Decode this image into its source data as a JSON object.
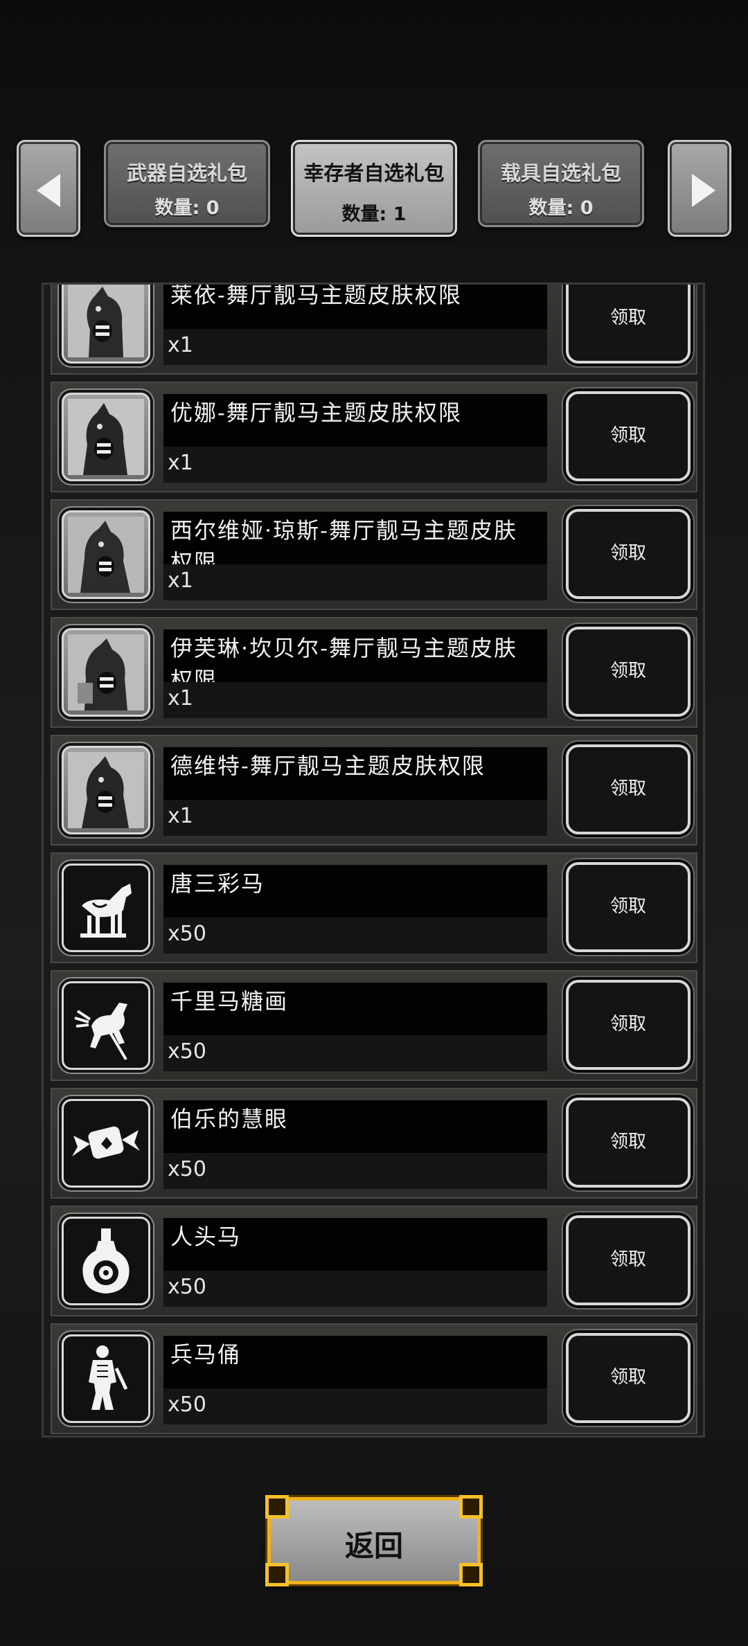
{
  "tabs": [
    {
      "title": "武器自选礼包",
      "count_label": "数量: 0",
      "active": false
    },
    {
      "title": "幸存者自选礼包",
      "count_label": "数量: 1",
      "active": true
    },
    {
      "title": "载具自选礼包",
      "count_label": "数量: 0",
      "active": false
    }
  ],
  "icons": {
    "prev": "chevron-left-icon",
    "next": "chevron-right-icon"
  },
  "rewards": [
    {
      "name": "莱依-舞厅靓马主题皮肤权限",
      "qty": "x1",
      "claim": "领取",
      "icon": "horse-mask-portrait-icon"
    },
    {
      "name": "优娜-舞厅靓马主题皮肤权限",
      "qty": "x1",
      "claim": "领取",
      "icon": "horse-mask-portrait-icon"
    },
    {
      "name": "西尔维娅·琼斯-舞厅靓马主题皮肤权限",
      "qty": "x1",
      "claim": "领取",
      "icon": "horse-mask-portrait-icon"
    },
    {
      "name": "伊芙琳·坎贝尔-舞厅靓马主题皮肤权限",
      "qty": "x1",
      "claim": "领取",
      "icon": "horse-mask-portrait-icon"
    },
    {
      "name": "德维特-舞厅靓马主题皮肤权限",
      "qty": "x1",
      "claim": "领取",
      "icon": "horse-mask-portrait-icon"
    },
    {
      "name": "唐三彩马",
      "qty": "x50",
      "claim": "领取",
      "icon": "tang-horse-icon"
    },
    {
      "name": "千里马糖画",
      "qty": "x50",
      "claim": "领取",
      "icon": "sugar-horse-icon"
    },
    {
      "name": "伯乐的慧眼",
      "qty": "x50",
      "claim": "领取",
      "icon": "candy-icon"
    },
    {
      "name": "人头马",
      "qty": "x50",
      "claim": "领取",
      "icon": "bottle-icon"
    },
    {
      "name": "兵马俑",
      "qty": "x50",
      "claim": "领取",
      "icon": "terracotta-warrior-icon"
    }
  ],
  "back_label": "返回",
  "colors": {
    "accent_gold": "#f0b21d",
    "panel_bg": "#1b1b1b",
    "row_bg": "#33332f"
  }
}
